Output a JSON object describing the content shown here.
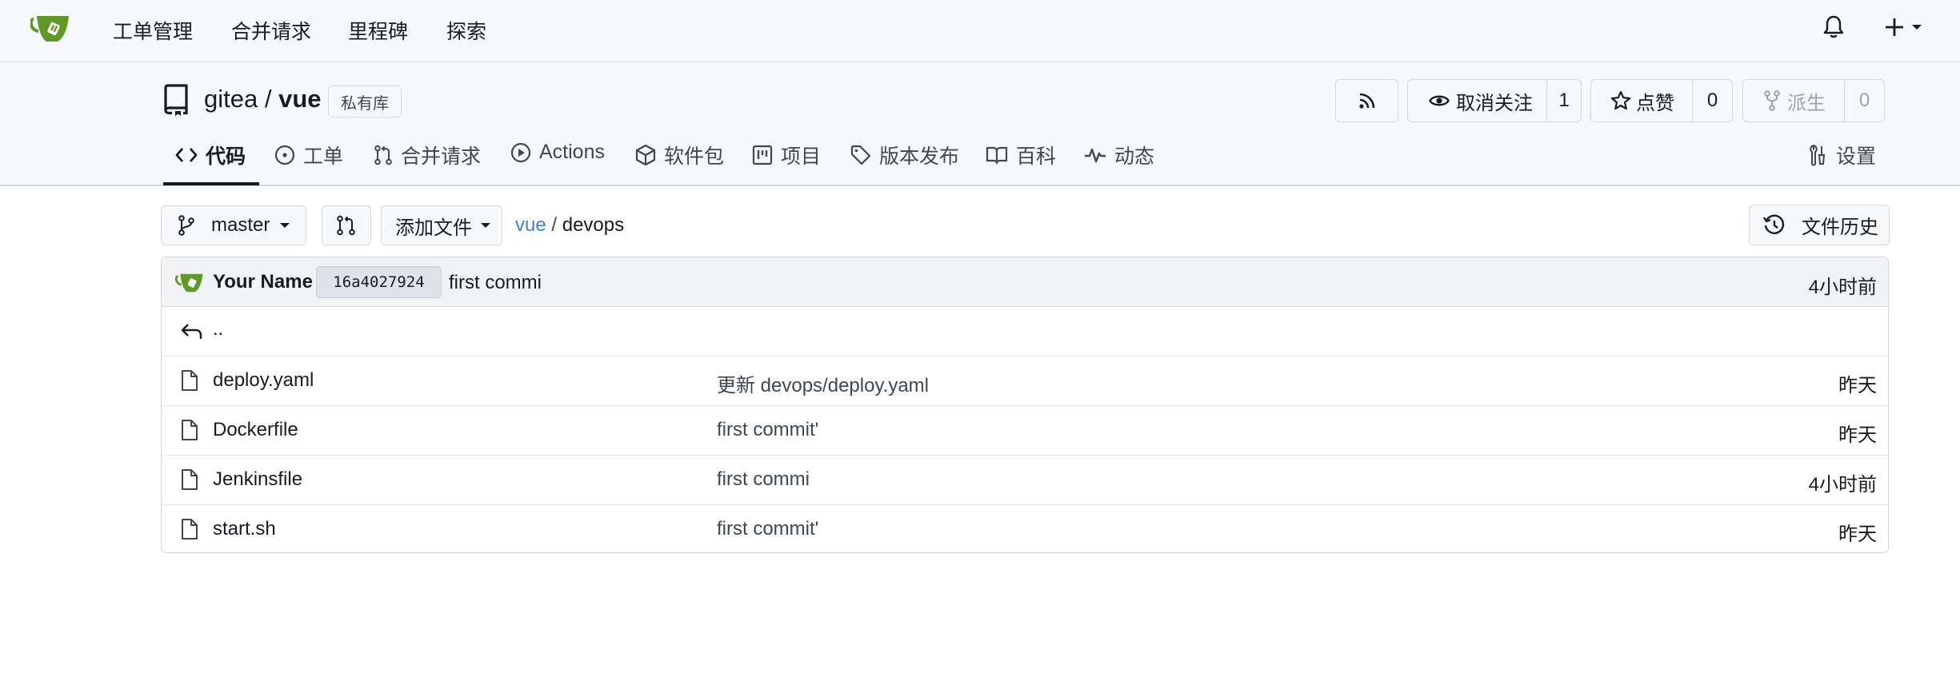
{
  "nav": {
    "links": [
      "工单管理",
      "合并请求",
      "里程碑",
      "探索"
    ]
  },
  "repo": {
    "owner": "gitea",
    "separator": " / ",
    "name": "vue",
    "private_label": "私有库",
    "unwatch_label": "取消关注",
    "watch_count": "1",
    "star_label": "点赞",
    "star_count": "0",
    "fork_label": "派生",
    "fork_count": "0"
  },
  "tabs": {
    "code": "代码",
    "issues": "工单",
    "pulls": "合并请求",
    "actions": "Actions",
    "packages": "软件包",
    "projects": "项目",
    "releases": "版本发布",
    "wiki": "百科",
    "activity": "动态",
    "settings": "设置"
  },
  "toolbar": {
    "branch": "master",
    "add_file": "添加文件",
    "breadcrumb_root": "vue",
    "breadcrumb_sep": " / ",
    "breadcrumb_dir": "devops",
    "history": "文件历史"
  },
  "latest_commit": {
    "author": "Your Name",
    "sha": "16a4027924",
    "message": "first commi",
    "time": "4小时前"
  },
  "parent_dir": "..",
  "files": [
    {
      "name": "deploy.yaml",
      "message": "更新 devops/deploy.yaml",
      "time": "昨天"
    },
    {
      "name": "Dockerfile",
      "message": "first commit'",
      "time": "昨天"
    },
    {
      "name": "Jenkinsfile",
      "message": "first commi",
      "time": "4小时前"
    },
    {
      "name": "start.sh",
      "message": "first commit'",
      "time": "昨天"
    }
  ],
  "colors": {
    "brand": "#609926",
    "link": "#4183c4",
    "header_bg": "#f8f9fb",
    "border": "#d0d7de"
  }
}
